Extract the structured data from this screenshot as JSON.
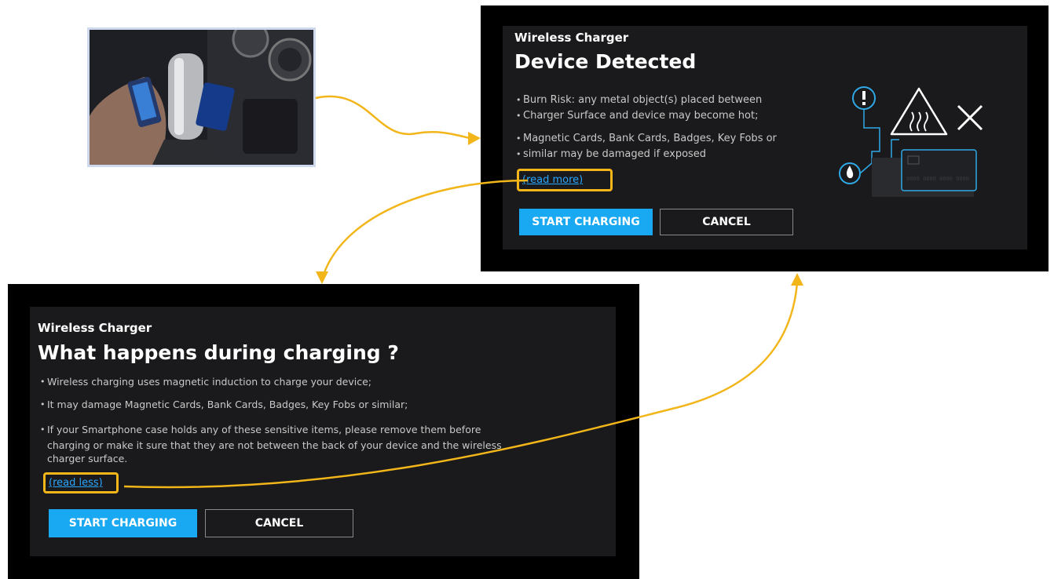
{
  "screen1": {
    "kicker": "Wireless Charger",
    "title": "Device Detected",
    "bullets": [
      "Burn Risk: any metal object(s) placed between",
      "Charger Surface and device may become hot;",
      "Magnetic Cards, Bank Cards, Badges, Key Fobs or",
      "similar may be damaged if exposed"
    ],
    "read_more": "(read more)",
    "start_label": "START CHARGING",
    "cancel_label": "CANCEL",
    "illustration_card_number": "0000 0000 0000 0000"
  },
  "screen2": {
    "kicker": "Wireless Charger",
    "title": "What happens during charging ?",
    "bullets": [
      "Wireless charging uses magnetic induction to charge your device;",
      "It may damage Magnetic Cards, Bank Cards, Badges, Key Fobs or similar;",
      "If your Smartphone case holds any of these sensitive items, please remove them before",
      "charging or make it sure that they are not between the back of your device and the wireless",
      "charger surface."
    ],
    "read_less": "(read less)",
    "start_label": "START CHARGING",
    "cancel_label": "CANCEL"
  },
  "icons": {
    "alert": "exclamation-circle-icon",
    "warning": "warning-triangle-heat-icon",
    "cross": "close-icon",
    "flame": "flame-icon",
    "card": "bank-card-icon"
  },
  "colors": {
    "accent": "#19a8f2",
    "link": "#2aa6ff",
    "highlight": "#f2b51a",
    "panel": "#1a1a1c",
    "frame": "#000000"
  }
}
